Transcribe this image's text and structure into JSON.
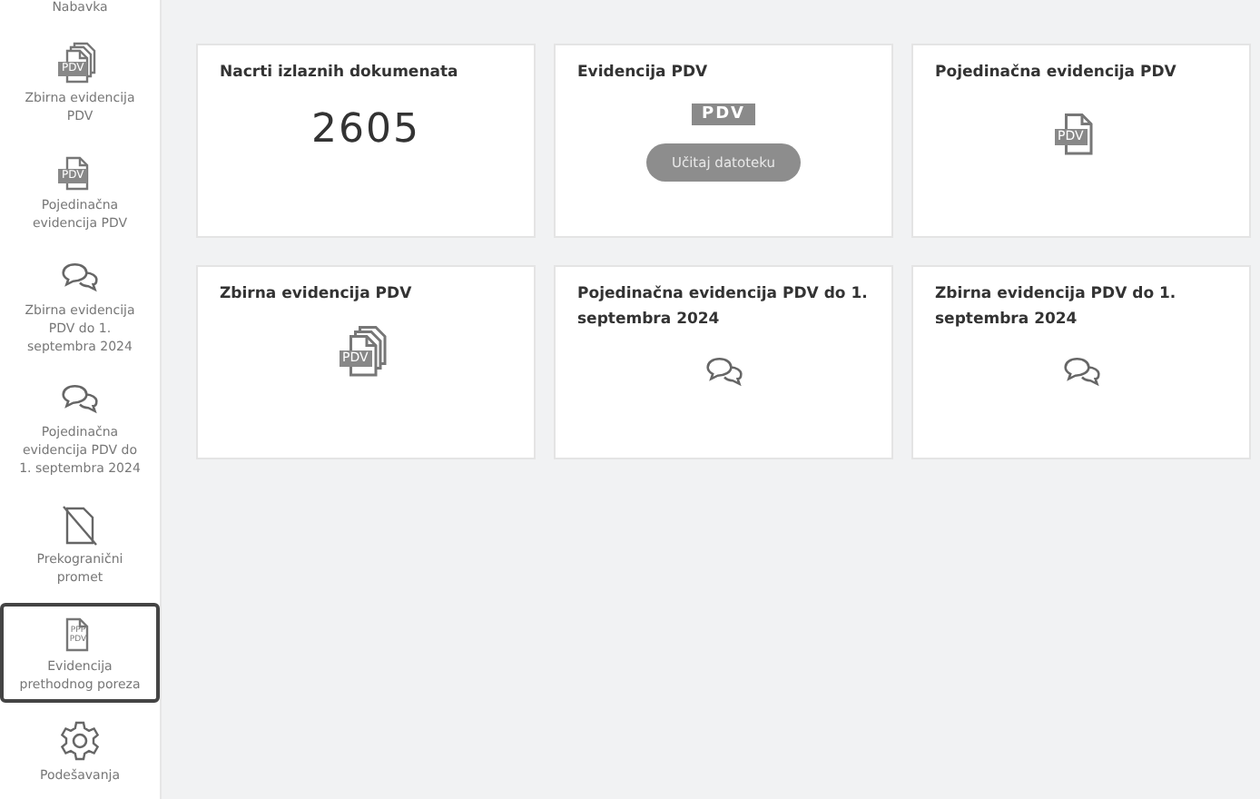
{
  "sidebar": {
    "items": [
      {
        "label": "Nabavka",
        "kind": "text",
        "selected": false
      },
      {
        "label": "Zbirna evidencija PDV",
        "kind": "doc-stack",
        "icon_text": "PDV",
        "selected": false
      },
      {
        "label": "Pojedinačna evidencija PDV",
        "kind": "doc",
        "icon_text": "PDV",
        "selected": false
      },
      {
        "label": "Zbirna evidencija PDV do 1. septembra 2024",
        "kind": "chat",
        "selected": false
      },
      {
        "label": "Pojedinačna evidencija PDV do 1. septembra 2024",
        "kind": "chat",
        "selected": false
      },
      {
        "label": "Prekogranični promet",
        "kind": "doc-slash",
        "selected": false
      },
      {
        "label": "Evidencija prethodnog poreza",
        "kind": "doc-ppp",
        "icon_text": "PPP PDV",
        "selected": true
      },
      {
        "label": "Podešavanja",
        "kind": "gear",
        "selected": false
      }
    ]
  },
  "cards": [
    {
      "kind": "count",
      "title": "Nacrti izlaznih dokumenata",
      "value": "2605"
    },
    {
      "kind": "upload",
      "title": "Evidencija PDV",
      "badge": "PDV",
      "button": "Učitaj datoteku"
    },
    {
      "kind": "doc",
      "title": "Pojedinačna evidencija PDV",
      "icon_text": "PDV"
    },
    {
      "kind": "doc-stack",
      "title": "Zbirna evidencija PDV",
      "icon_text": "PDV"
    },
    {
      "kind": "chat",
      "title": "Pojedinačna evidencija PDV do 1. septembra 2024"
    },
    {
      "kind": "chat",
      "title": "Zbirna evidencija PDV do 1. septembra 2024"
    }
  ]
}
